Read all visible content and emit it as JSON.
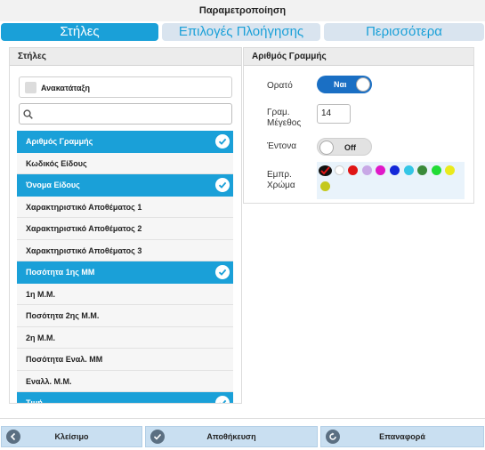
{
  "window_title": "Παραμετροποίηση",
  "tabs": [
    "Στήλες",
    "Επιλογές Πλοήγησης",
    "Περισσότερα"
  ],
  "left_panel": {
    "header": "Στήλες",
    "reorder_label": "Ανακατάταξη",
    "search_placeholder": "",
    "columns": [
      {
        "label": "Αριθμός Γραμμής",
        "selected": true
      },
      {
        "label": "Κωδικός Είδους",
        "selected": false
      },
      {
        "label": "Όνομα Είδους",
        "selected": true
      },
      {
        "label": "Χαρακτηριστικό Αποθέματος 1",
        "selected": false
      },
      {
        "label": "Χαρακτηριστικό Αποθέματος 2",
        "selected": false
      },
      {
        "label": "Χαρακτηριστικό Αποθέματος 3",
        "selected": false
      },
      {
        "label": "Ποσότητα 1ης ΜΜ",
        "selected": true
      },
      {
        "label": "1η Μ.Μ.",
        "selected": false
      },
      {
        "label": "Ποσότητα 2ης Μ.Μ.",
        "selected": false
      },
      {
        "label": "2η Μ.Μ.",
        "selected": false
      },
      {
        "label": "Ποσότητα Εναλ. ΜΜ",
        "selected": false
      },
      {
        "label": "Εναλλ. Μ.Μ.",
        "selected": false
      },
      {
        "label": "Τιμή",
        "selected": true
      }
    ]
  },
  "right_panel": {
    "header": "Αριθμός Γραμμής",
    "visible_label": "Ορατό",
    "visible_value": "Ναι",
    "size_label_1": "Γραμ.",
    "size_label_2": "Μέγεθος",
    "size_value": "14",
    "bold_label": "Έντονα",
    "bold_value": "Off",
    "color_label_1": "Εμπρ.",
    "color_label_2": "Χρώμα",
    "colors": [
      "#111111",
      "#ffffff",
      "#e01515",
      "#c8a8e6",
      "#e018c8",
      "#1428d8",
      "#34c6e6",
      "#3a8a3a",
      "#22dc36",
      "#eaea1c",
      "#c4c81c"
    ],
    "selected_color_index": 0
  },
  "footer": {
    "close_label": "Κλείσιμο",
    "save_label": "Αποθήκευση",
    "reset_label": "Επαναφορά"
  }
}
